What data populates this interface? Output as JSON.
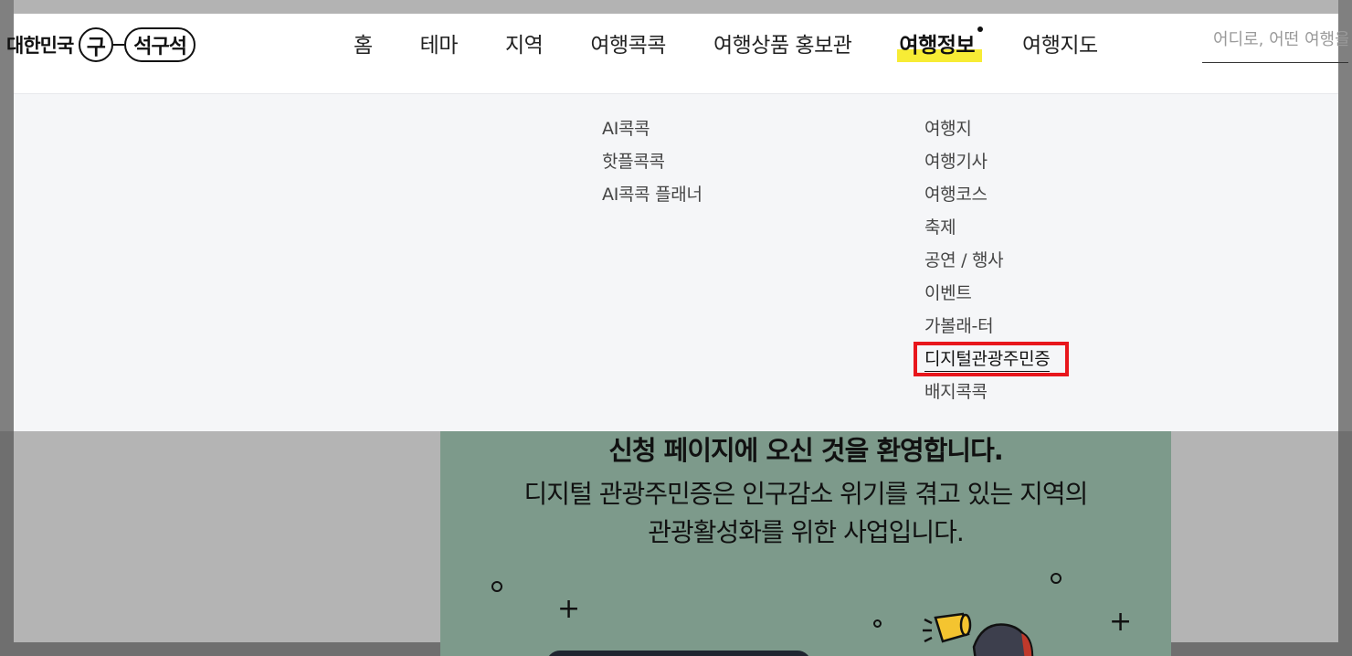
{
  "logo": {
    "main": "대한민국",
    "circle": "구",
    "pill": "석구석"
  },
  "nav": {
    "items": [
      {
        "label": "홈"
      },
      {
        "label": "테마"
      },
      {
        "label": "지역"
      },
      {
        "label": "여행콕콕"
      },
      {
        "label": "여행상품 홍보관"
      },
      {
        "label": "여행정보",
        "active": true
      },
      {
        "label": "여행지도"
      }
    ]
  },
  "search": {
    "placeholder": "어디로, 어떤 여행을"
  },
  "megamenu": {
    "col1": [
      "AI콕콕",
      "핫플콕콕",
      "AI콕콕 플래너"
    ],
    "col2": [
      "여행지",
      "여행기사",
      "여행코스",
      "축제",
      "공연 / 행사",
      "이벤트",
      "가볼래-터",
      "디지털관광주민증",
      "배지콕콕"
    ],
    "highlighted": "디지털관광주민증"
  },
  "banner": {
    "title": "신청 페이지에 오신 것을 환영합니다.",
    "line1": "디지털 관광주민증은 인구감소 위기를 겪고 있는 지역의",
    "line2": "관광활성화를 위한 사업입니다."
  },
  "colors": {
    "highlight": "#f7ec35",
    "annotation": "#e8161c",
    "banner": "#7d9a8b"
  }
}
